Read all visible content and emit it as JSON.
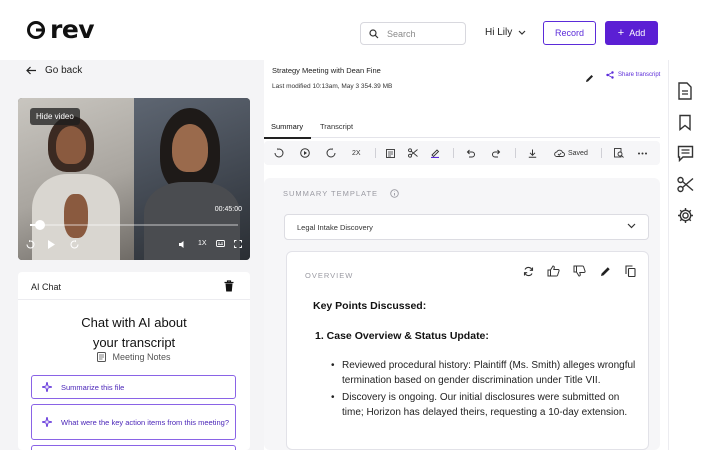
{
  "header": {
    "logo_text": "rev",
    "search_placeholder": "Search",
    "user_name": "Hi Lily",
    "record_label": "Record",
    "add_label": "Add"
  },
  "left_panel": {
    "back_label": "Go back",
    "video": {
      "hide_video_label": "Hide video",
      "timecode": "00:45:00",
      "speed_label": "1X",
      "progress": 0.05
    },
    "ai_chat": {
      "title": "AI Chat",
      "heading_line1": "Chat with AI about",
      "heading_line2": "your transcript",
      "source_label": "Meeting Notes",
      "prompts": [
        {
          "text": "Summarize this file"
        },
        {
          "text": "What were the key action items from this meeting?"
        }
      ]
    }
  },
  "document": {
    "title": "Strategy Meeting with Dean Fine",
    "meta": "Last modified 10:13am, May 3 354.39 MB",
    "share_label": "Share transcript",
    "tabs": [
      {
        "label": "Summary"
      },
      {
        "label": "Transcript"
      }
    ],
    "toolbar": {
      "speed_label": "2X",
      "saved_label": "Saved"
    }
  },
  "summary": {
    "template_label": "SUMMARY TEMPLATE",
    "template_value": "Legal Intake Discovery",
    "overview_label": "OVERVIEW",
    "heading": "Key Points Discussed:",
    "subheading": "1. Case Overview & Status Update:",
    "bullets": [
      {
        "text": "Reviewed procedural history: Plaintiff (Ms. Smith) alleges wrongful termination based on gender discrimination under Title VII."
      },
      {
        "text": "Discovery is ongoing. Our initial disclosures were submitted on time; Horizon has delayed theirs, requesting a 10-day extension."
      }
    ]
  },
  "colors": {
    "accent": "#5b1fd4",
    "accent_outline": "#5b2bd9",
    "panel_bg": "#f4f4f6"
  }
}
